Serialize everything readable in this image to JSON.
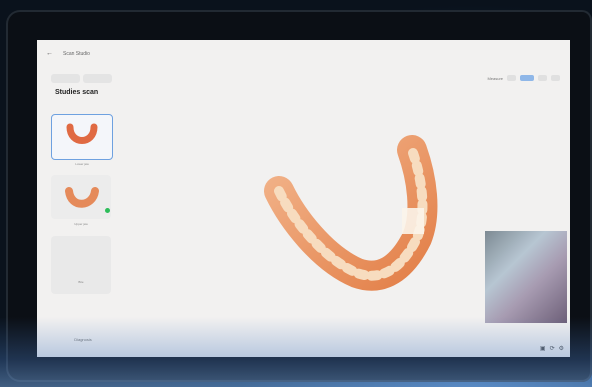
{
  "app": {
    "title": "Scan Studio"
  },
  "toolbar": {
    "label": "Measure"
  },
  "sidebar": {
    "tabs": [
      "",
      ""
    ],
    "heading": "Studies scan",
    "items": [
      {
        "label": "Lower jaw",
        "selected": true
      },
      {
        "label": "Upper jaw",
        "selected": false,
        "status": "done"
      },
      {
        "label": "Bite"
      }
    ],
    "bottom_label": "Diagnosis"
  },
  "colors": {
    "accent": "#8fb7e8",
    "done": "#2dbd5a"
  }
}
